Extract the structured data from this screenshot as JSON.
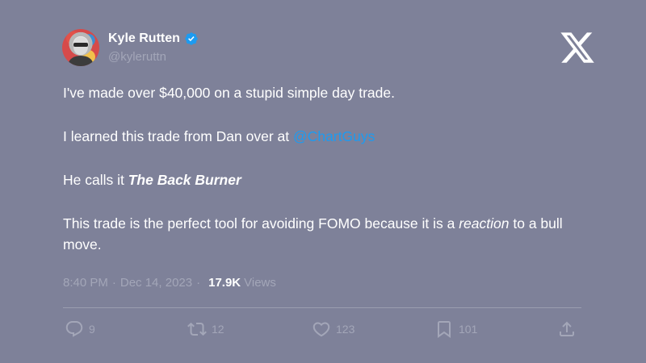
{
  "author": {
    "name": "Kyle Rutten",
    "handle": "@kyleruttn"
  },
  "tweet": {
    "line1": "I've made over $40,000 on a stupid simple day trade.",
    "line2_prefix": "I learned this trade from Dan over at ",
    "line2_mention": "@ChartGuys",
    "line3_prefix": "He calls it ",
    "line3_emphasis": "The Back Burner",
    "line4_prefix": "This trade is the perfect tool for avoiding FOMO because it is a ",
    "line4_italic": "reaction",
    "line4_suffix": " to a bull move."
  },
  "meta": {
    "time": "8:40 PM",
    "date": "Dec 14, 2023",
    "separator": "·",
    "views_count": "17.9K",
    "views_label": "Views"
  },
  "actions": {
    "replies": "9",
    "retweets": "12",
    "likes": "123",
    "bookmarks": "101"
  },
  "icons": [
    "verified-badge-icon",
    "x-logo-icon",
    "reply-icon",
    "retweet-icon",
    "like-icon",
    "bookmark-icon",
    "share-icon"
  ],
  "colors": {
    "background": "#7e8199",
    "link": "#1d9bf0",
    "verified": "#1d9bf0",
    "muted": "#a3a6b8"
  }
}
